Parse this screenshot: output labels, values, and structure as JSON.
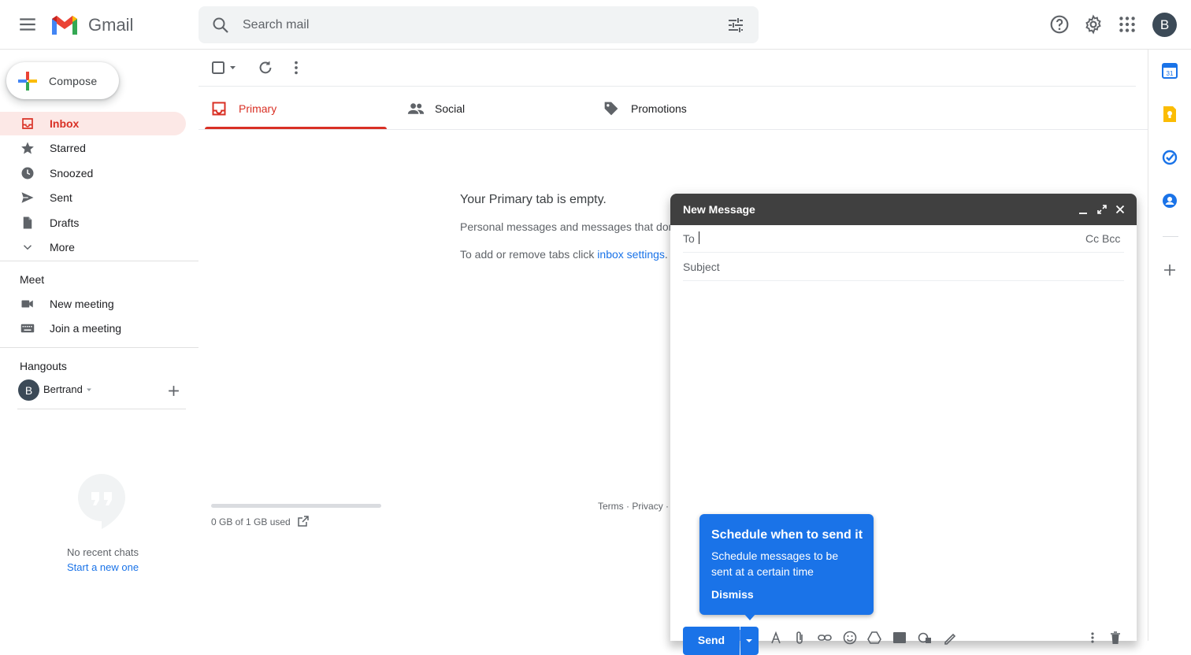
{
  "colors": {
    "accent": "#1a73e8",
    "inbox_red": "#d93025",
    "compose_header": "#404040"
  },
  "header": {
    "logo_text": "Gmail",
    "search_placeholder": "Search mail",
    "avatar_initial": "B"
  },
  "sidebar": {
    "compose_label": "Compose",
    "items": [
      {
        "label": "Inbox",
        "icon": "inbox-icon",
        "active": true
      },
      {
        "label": "Starred",
        "icon": "star-icon"
      },
      {
        "label": "Snoozed",
        "icon": "clock-icon"
      },
      {
        "label": "Sent",
        "icon": "send-icon"
      },
      {
        "label": "Drafts",
        "icon": "draft-icon"
      },
      {
        "label": "More",
        "icon": "chevron-down-icon"
      }
    ],
    "meet": {
      "title": "Meet",
      "items": [
        {
          "label": "New meeting",
          "icon": "video-camera-icon"
        },
        {
          "label": "Join a meeting",
          "icon": "keyboard-icon"
        }
      ]
    },
    "hangouts": {
      "title": "Hangouts",
      "user_initial": "B",
      "user_name": "Bertrand",
      "no_chats": "No recent chats",
      "start_new": "Start a new one"
    }
  },
  "tabs": [
    {
      "label": "Primary",
      "icon": "inbox-icon",
      "active": true
    },
    {
      "label": "Social",
      "icon": "people-icon"
    },
    {
      "label": "Promotions",
      "icon": "tag-icon"
    }
  ],
  "main": {
    "empty_title": "Your Primary tab is empty.",
    "empty_line1": "Personal messages and messages that don",
    "empty_line2_prefix": "To add or remove tabs click ",
    "empty_line2_link": "inbox settings",
    "empty_line2_suffix": ".",
    "storage_used_fraction": 0.0,
    "storage_text": "0 GB of 1 GB used",
    "footer_terms": "Terms",
    "footer_sep": "·",
    "footer_privacy": "Privacy",
    "footer_trailing": "·"
  },
  "compose_window": {
    "title": "New Message",
    "to_label": "To",
    "cc_bcc": "Cc Bcc",
    "subject_placeholder": "Subject",
    "send_label": "Send"
  },
  "tooltip": {
    "title": "Schedule when to send it",
    "body_line1": "Schedule messages to be",
    "body_line2": "sent at a certain time",
    "dismiss": "Dismiss"
  }
}
